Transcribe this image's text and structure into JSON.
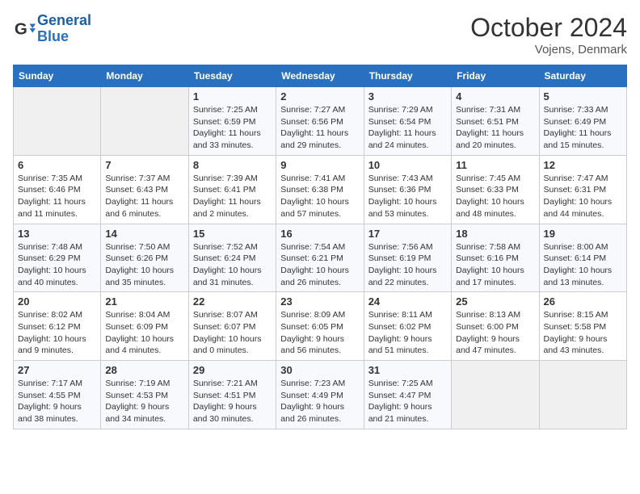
{
  "header": {
    "logo_line1": "General",
    "logo_line2": "Blue",
    "month": "October 2024",
    "location": "Vojens, Denmark"
  },
  "weekdays": [
    "Sunday",
    "Monday",
    "Tuesday",
    "Wednesday",
    "Thursday",
    "Friday",
    "Saturday"
  ],
  "weeks": [
    [
      {
        "day": "",
        "sunrise": "",
        "sunset": "",
        "daylight": ""
      },
      {
        "day": "",
        "sunrise": "",
        "sunset": "",
        "daylight": ""
      },
      {
        "day": "1",
        "sunrise": "Sunrise: 7:25 AM",
        "sunset": "Sunset: 6:59 PM",
        "daylight": "Daylight: 11 hours and 33 minutes."
      },
      {
        "day": "2",
        "sunrise": "Sunrise: 7:27 AM",
        "sunset": "Sunset: 6:56 PM",
        "daylight": "Daylight: 11 hours and 29 minutes."
      },
      {
        "day": "3",
        "sunrise": "Sunrise: 7:29 AM",
        "sunset": "Sunset: 6:54 PM",
        "daylight": "Daylight: 11 hours and 24 minutes."
      },
      {
        "day": "4",
        "sunrise": "Sunrise: 7:31 AM",
        "sunset": "Sunset: 6:51 PM",
        "daylight": "Daylight: 11 hours and 20 minutes."
      },
      {
        "day": "5",
        "sunrise": "Sunrise: 7:33 AM",
        "sunset": "Sunset: 6:49 PM",
        "daylight": "Daylight: 11 hours and 15 minutes."
      }
    ],
    [
      {
        "day": "6",
        "sunrise": "Sunrise: 7:35 AM",
        "sunset": "Sunset: 6:46 PM",
        "daylight": "Daylight: 11 hours and 11 minutes."
      },
      {
        "day": "7",
        "sunrise": "Sunrise: 7:37 AM",
        "sunset": "Sunset: 6:43 PM",
        "daylight": "Daylight: 11 hours and 6 minutes."
      },
      {
        "day": "8",
        "sunrise": "Sunrise: 7:39 AM",
        "sunset": "Sunset: 6:41 PM",
        "daylight": "Daylight: 11 hours and 2 minutes."
      },
      {
        "day": "9",
        "sunrise": "Sunrise: 7:41 AM",
        "sunset": "Sunset: 6:38 PM",
        "daylight": "Daylight: 10 hours and 57 minutes."
      },
      {
        "day": "10",
        "sunrise": "Sunrise: 7:43 AM",
        "sunset": "Sunset: 6:36 PM",
        "daylight": "Daylight: 10 hours and 53 minutes."
      },
      {
        "day": "11",
        "sunrise": "Sunrise: 7:45 AM",
        "sunset": "Sunset: 6:33 PM",
        "daylight": "Daylight: 10 hours and 48 minutes."
      },
      {
        "day": "12",
        "sunrise": "Sunrise: 7:47 AM",
        "sunset": "Sunset: 6:31 PM",
        "daylight": "Daylight: 10 hours and 44 minutes."
      }
    ],
    [
      {
        "day": "13",
        "sunrise": "Sunrise: 7:48 AM",
        "sunset": "Sunset: 6:29 PM",
        "daylight": "Daylight: 10 hours and 40 minutes."
      },
      {
        "day": "14",
        "sunrise": "Sunrise: 7:50 AM",
        "sunset": "Sunset: 6:26 PM",
        "daylight": "Daylight: 10 hours and 35 minutes."
      },
      {
        "day": "15",
        "sunrise": "Sunrise: 7:52 AM",
        "sunset": "Sunset: 6:24 PM",
        "daylight": "Daylight: 10 hours and 31 minutes."
      },
      {
        "day": "16",
        "sunrise": "Sunrise: 7:54 AM",
        "sunset": "Sunset: 6:21 PM",
        "daylight": "Daylight: 10 hours and 26 minutes."
      },
      {
        "day": "17",
        "sunrise": "Sunrise: 7:56 AM",
        "sunset": "Sunset: 6:19 PM",
        "daylight": "Daylight: 10 hours and 22 minutes."
      },
      {
        "day": "18",
        "sunrise": "Sunrise: 7:58 AM",
        "sunset": "Sunset: 6:16 PM",
        "daylight": "Daylight: 10 hours and 17 minutes."
      },
      {
        "day": "19",
        "sunrise": "Sunrise: 8:00 AM",
        "sunset": "Sunset: 6:14 PM",
        "daylight": "Daylight: 10 hours and 13 minutes."
      }
    ],
    [
      {
        "day": "20",
        "sunrise": "Sunrise: 8:02 AM",
        "sunset": "Sunset: 6:12 PM",
        "daylight": "Daylight: 10 hours and 9 minutes."
      },
      {
        "day": "21",
        "sunrise": "Sunrise: 8:04 AM",
        "sunset": "Sunset: 6:09 PM",
        "daylight": "Daylight: 10 hours and 4 minutes."
      },
      {
        "day": "22",
        "sunrise": "Sunrise: 8:07 AM",
        "sunset": "Sunset: 6:07 PM",
        "daylight": "Daylight: 10 hours and 0 minutes."
      },
      {
        "day": "23",
        "sunrise": "Sunrise: 8:09 AM",
        "sunset": "Sunset: 6:05 PM",
        "daylight": "Daylight: 9 hours and 56 minutes."
      },
      {
        "day": "24",
        "sunrise": "Sunrise: 8:11 AM",
        "sunset": "Sunset: 6:02 PM",
        "daylight": "Daylight: 9 hours and 51 minutes."
      },
      {
        "day": "25",
        "sunrise": "Sunrise: 8:13 AM",
        "sunset": "Sunset: 6:00 PM",
        "daylight": "Daylight: 9 hours and 47 minutes."
      },
      {
        "day": "26",
        "sunrise": "Sunrise: 8:15 AM",
        "sunset": "Sunset: 5:58 PM",
        "daylight": "Daylight: 9 hours and 43 minutes."
      }
    ],
    [
      {
        "day": "27",
        "sunrise": "Sunrise: 7:17 AM",
        "sunset": "Sunset: 4:55 PM",
        "daylight": "Daylight: 9 hours and 38 minutes."
      },
      {
        "day": "28",
        "sunrise": "Sunrise: 7:19 AM",
        "sunset": "Sunset: 4:53 PM",
        "daylight": "Daylight: 9 hours and 34 minutes."
      },
      {
        "day": "29",
        "sunrise": "Sunrise: 7:21 AM",
        "sunset": "Sunset: 4:51 PM",
        "daylight": "Daylight: 9 hours and 30 minutes."
      },
      {
        "day": "30",
        "sunrise": "Sunrise: 7:23 AM",
        "sunset": "Sunset: 4:49 PM",
        "daylight": "Daylight: 9 hours and 26 minutes."
      },
      {
        "day": "31",
        "sunrise": "Sunrise: 7:25 AM",
        "sunset": "Sunset: 4:47 PM",
        "daylight": "Daylight: 9 hours and 21 minutes."
      },
      {
        "day": "",
        "sunrise": "",
        "sunset": "",
        "daylight": ""
      },
      {
        "day": "",
        "sunrise": "",
        "sunset": "",
        "daylight": ""
      }
    ]
  ]
}
